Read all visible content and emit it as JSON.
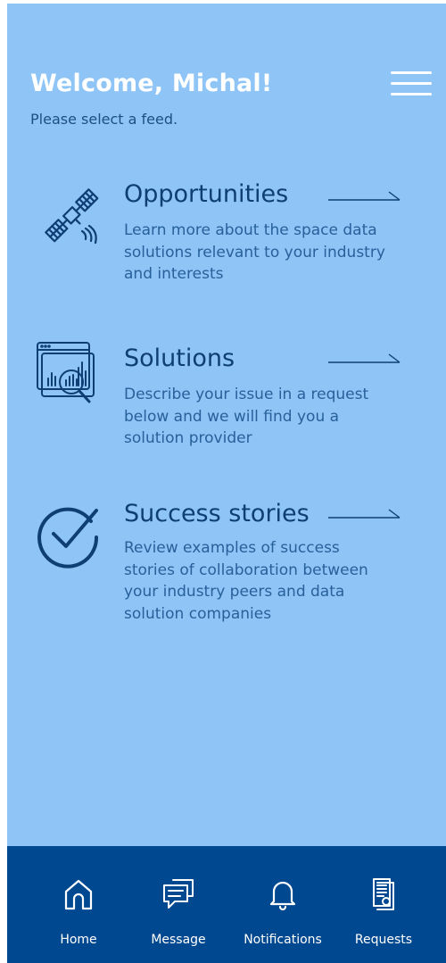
{
  "header": {
    "title": "Welcome, Michal!",
    "subtitle": "Please select a feed."
  },
  "feeds": [
    {
      "icon": "satellite-icon",
      "title": "Opportunities",
      "description": "Learn more about the space data solutions relevant to your industry and interests"
    },
    {
      "icon": "data-search-icon",
      "title": "Solutions",
      "description": "Describe your issue in a request below and we will find you a solution provider"
    },
    {
      "icon": "check-circle-icon",
      "title": "Success stories",
      "description": "Review examples of success stories of collaboration between your industry peers and data solution companies"
    }
  ],
  "nav": [
    {
      "icon": "home-icon",
      "label": "Home"
    },
    {
      "icon": "message-icon",
      "label": "Message"
    },
    {
      "icon": "bell-icon",
      "label": "Notifications"
    },
    {
      "icon": "document-icon",
      "label": "Requests"
    }
  ],
  "colors": {
    "background": "#8ec4f6",
    "navbar": "#00488f",
    "heading": "#0e3e74",
    "text": "#28609a"
  }
}
